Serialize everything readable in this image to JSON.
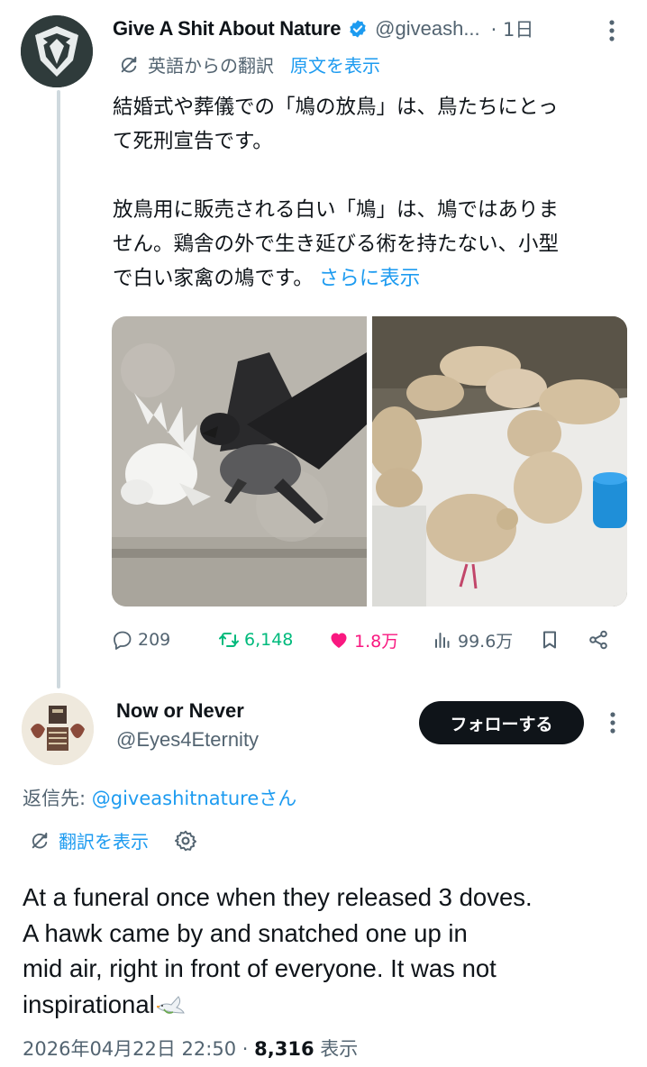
{
  "tweet": {
    "author_name": "Give A Shit About Nature",
    "handle": "@giveash...",
    "time": "1日",
    "translation": {
      "label": "英語からの翻訳",
      "show_original": "原文を表示"
    },
    "text_lines": [
      "結婚式や葬儀での「鳩の放鳥」は、鳥たちにとっ",
      "て死刑宣告です。",
      "放鳥用に販売される白い「鳩」は、鳩ではありま",
      "せん。鶏舎の外で生き延びる術を持たない、小型",
      "で白い家禽の鳩です。"
    ],
    "show_more": "さらに表示",
    "stats": {
      "replies": "209",
      "retweets": "6,148",
      "likes": "1.8万",
      "views": "99.6万"
    }
  },
  "reply": {
    "author_name": "Now or Never",
    "handle": "@Eyes4Eternity",
    "follow_label": "フォローする",
    "reply_to_prefix": "返信先: ",
    "reply_to_handle": "@giveashitnatureさん",
    "translate_label": "翻訳を表示",
    "text_lines": [
      "At a funeral once when they released 3 doves.",
      "A hawk came by and snatched one up in",
      "mid air, right in front of everyone. It was not",
      "inspirational"
    ],
    "timestamp": "2026年04月22日 22:50",
    "view_count": "8,316",
    "view_label": "表示"
  },
  "colors": {
    "link": "#1d9bf0",
    "secondary": "#536471",
    "retweet": "#00ba7c",
    "like": "#f91880",
    "verified": "#1d9bf0"
  }
}
